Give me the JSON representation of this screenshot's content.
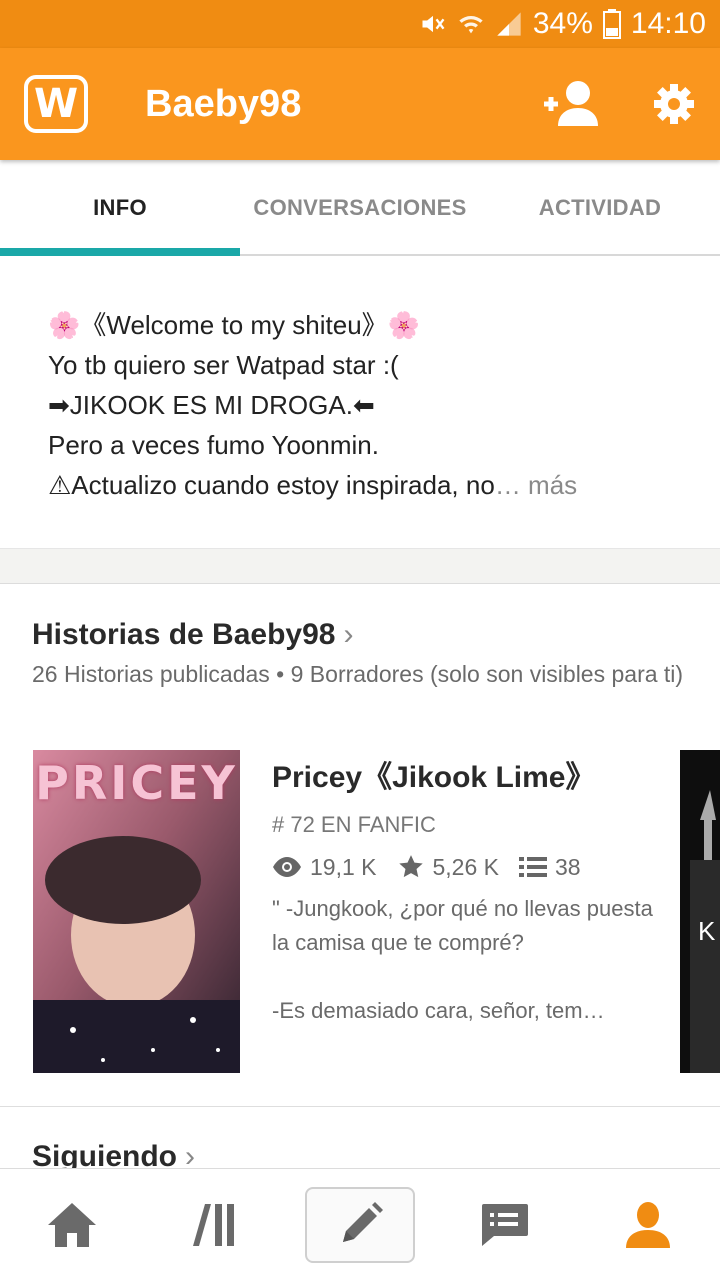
{
  "status_bar": {
    "battery": "34%",
    "time": "14:10",
    "icons": [
      "mute-icon",
      "wifi-icon",
      "signal-icon",
      "battery-icon"
    ]
  },
  "app_bar": {
    "logo_letter": "W",
    "username": "Baeby98",
    "actions": [
      "follow-user-icon",
      "settings-icon"
    ],
    "color": "#fa961e"
  },
  "tabs": [
    {
      "label": "INFO",
      "active": true
    },
    {
      "label": "CONVERSACIONES",
      "active": false
    },
    {
      "label": "ACTIVIDAD",
      "active": false
    }
  ],
  "bio": {
    "lines": [
      "🌸《Welcome to my shiteu》🌸",
      "Yo tb quiero ser Watpad star :(",
      "➡JIKOOK ES MI DROGA.⬅",
      "Pero a veces fumo Yoonmin.",
      "⚠Actualizo cuando estoy inspirada, no"
    ],
    "more": "… más"
  },
  "stories": {
    "title": "Historias de Baeby98",
    "subtitle": "26 Historias publicadas • 9 Borradores (solo son visibles para ti)",
    "items": [
      {
        "cover_text": "PRICEY",
        "title": "Pricey《Jikook Lime》",
        "rank": "# 72 EN FANFIC",
        "reads": "19,1 K",
        "votes": "5,26 K",
        "parts": "38",
        "description": "\"  -Jungkook, ¿por qué no llevas puesta la camisa que te compré?\n\n-Es demasiado cara, señor, tem…"
      }
    ],
    "peek_letter": "K"
  },
  "following": {
    "title": "Siguiendo"
  },
  "bottom_nav": [
    "home-icon",
    "library-icon",
    "write-icon",
    "messages-icon",
    "profile-icon"
  ],
  "accent": "#fa961e",
  "tab_indicator_color": "#1aa8a8"
}
